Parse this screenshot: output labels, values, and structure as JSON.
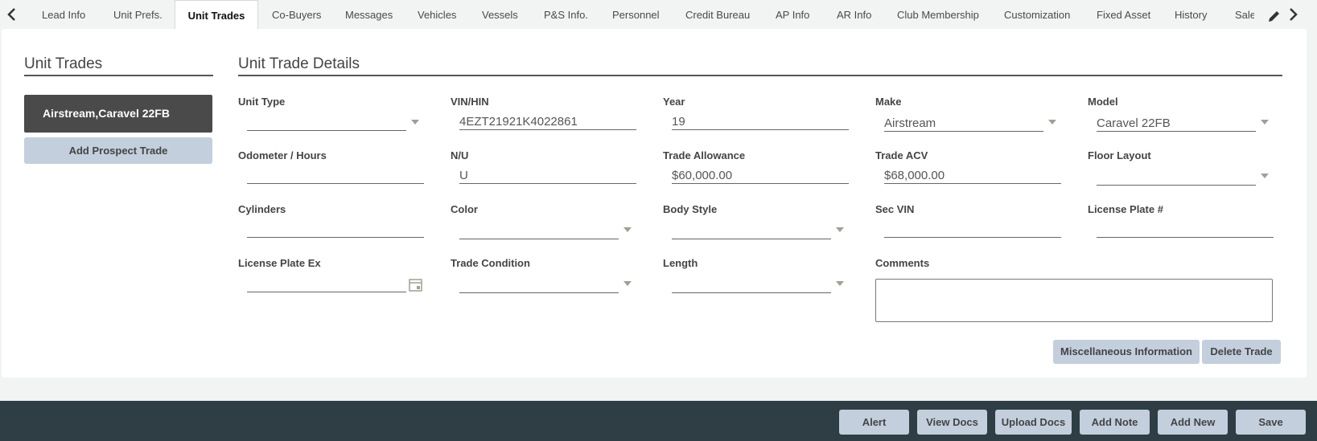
{
  "tabs": [
    {
      "label": "Lead Info"
    },
    {
      "label": "Unit Prefs."
    },
    {
      "label": "Unit Trades"
    },
    {
      "label": "Co-Buyers"
    },
    {
      "label": "Messages"
    },
    {
      "label": "Vehicles"
    },
    {
      "label": "Vessels"
    },
    {
      "label": "P&S Info."
    },
    {
      "label": "Personnel"
    },
    {
      "label": "Credit Bureau"
    },
    {
      "label": "AP Info"
    },
    {
      "label": "AR Info"
    },
    {
      "label": "Club Membership"
    },
    {
      "label": "Customization"
    },
    {
      "label": "Fixed Asset"
    },
    {
      "label": "History"
    },
    {
      "label": "Sale"
    }
  ],
  "active_tab": "Unit Trades",
  "icons": {
    "prev": "chevron-left-icon",
    "next": "chevron-right-icon",
    "edit": "pencil-icon",
    "calendar": "calendar-icon",
    "dropdown": "caret-down-icon"
  },
  "left": {
    "title": "Unit Trades",
    "trade_item": "Airstream,Caravel 22FB",
    "add_button": "Add Prospect Trade"
  },
  "details": {
    "title": "Unit Trade Details",
    "fields": {
      "unit_type": {
        "label": "Unit Type",
        "value": ""
      },
      "vin": {
        "label": "VIN/HIN",
        "value": "4EZT21921K4022861"
      },
      "year": {
        "label": "Year",
        "value": "19"
      },
      "make": {
        "label": "Make",
        "value": "Airstream"
      },
      "model": {
        "label": "Model",
        "value": "Caravel 22FB"
      },
      "odometer": {
        "label": "Odometer / Hours",
        "value": ""
      },
      "nu": {
        "label": "N/U",
        "value": "U"
      },
      "trade_allowance": {
        "label": "Trade Allowance",
        "value": "$60,000.00"
      },
      "trade_acv": {
        "label": "Trade ACV",
        "value": "$68,000.00"
      },
      "floor_layout": {
        "label": "Floor Layout",
        "value": ""
      },
      "cylinders": {
        "label": "Cylinders",
        "value": ""
      },
      "color": {
        "label": "Color",
        "value": ""
      },
      "body_style": {
        "label": "Body Style",
        "value": ""
      },
      "sec_vin": {
        "label": "Sec VIN",
        "value": ""
      },
      "license_plate": {
        "label": "License Plate #",
        "value": ""
      },
      "license_plate_ex": {
        "label": "License Plate Ex",
        "value": ""
      },
      "trade_condition": {
        "label": "Trade Condition",
        "value": ""
      },
      "length": {
        "label": "Length",
        "value": ""
      },
      "comments": {
        "label": "Comments",
        "value": ""
      }
    },
    "buttons": {
      "misc": "Miscellaneous Information",
      "delete": "Delete Trade"
    }
  },
  "footer": {
    "buttons": [
      "Alert",
      "View Docs",
      "Upload Docs",
      "Add Note",
      "Add New",
      "Save"
    ]
  }
}
